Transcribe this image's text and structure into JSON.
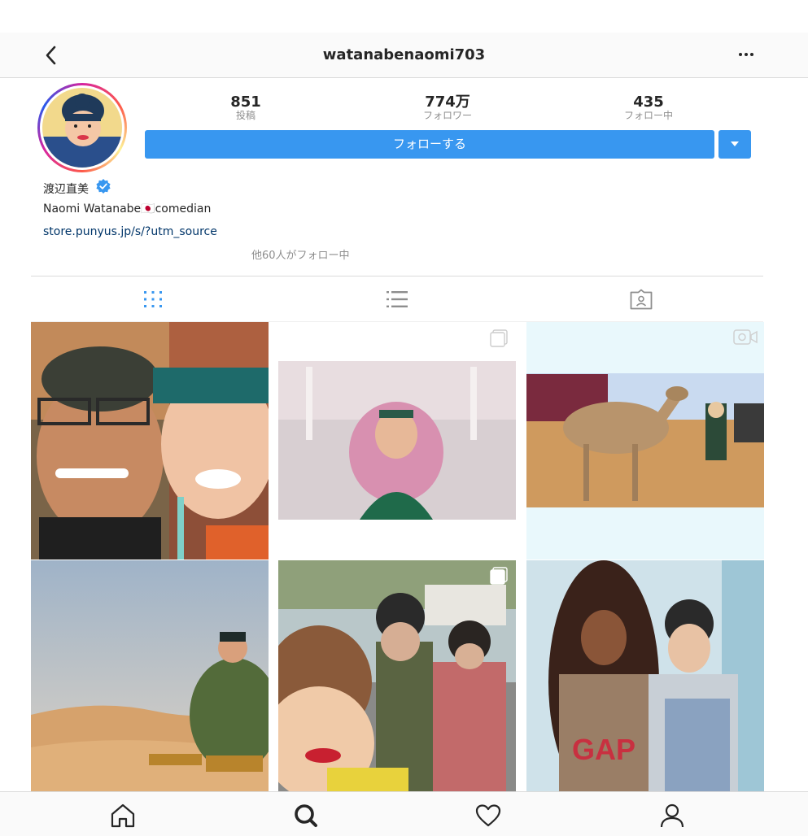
{
  "header": {
    "username": "watanabenaomi703"
  },
  "stats": [
    {
      "value": "851",
      "label": "投稿"
    },
    {
      "value": "774万",
      "label": "フォロワー"
    },
    {
      "value": "435",
      "label": "フォロー中"
    }
  ],
  "actions": {
    "follow_label": "フォローする"
  },
  "profile": {
    "full_name": "渡辺直美",
    "bio": "Naomi Watanabe🇯🇵comedian",
    "link": "store.punyus.jp/s/?utm_source",
    "followed_by": "他60人がフォロー中"
  },
  "tabs": [
    "grid-icon",
    "list-icon",
    "tagged-icon"
  ],
  "icons": {
    "back": "chevron-left-icon",
    "more": "more-horizontal-icon",
    "verified": "verified-badge-icon",
    "home": "home-icon",
    "search": "search-icon",
    "activity": "heart-icon",
    "profile": "profile-icon"
  },
  "colors": {
    "accent": "#3897f0",
    "link": "#003569",
    "verified": "#3897f0",
    "muted": "#8e8e8e"
  }
}
